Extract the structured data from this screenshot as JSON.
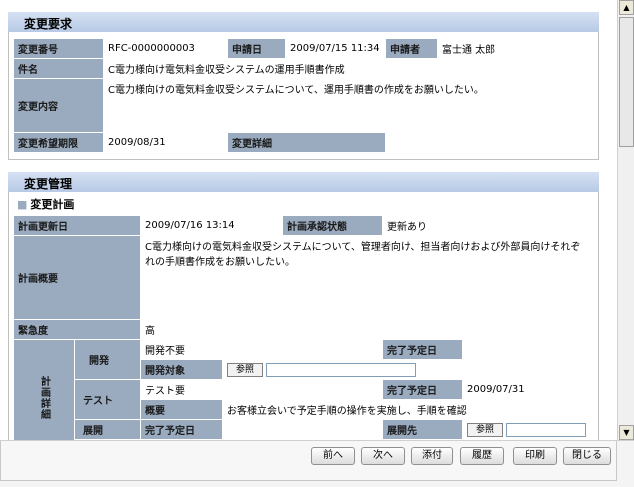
{
  "change_request": {
    "title": "変更要求",
    "number_label": "変更番号",
    "number_value": "RFC-0000000003",
    "date_label": "申請日",
    "date_value": "2009/07/15 11:34",
    "applicant_label": "申請者",
    "applicant_value": "富士通 太郎",
    "subject_label": "件名",
    "subject_value": "C電力様向け電気料金収受システムの運用手順書作成",
    "content_label": "変更内容",
    "content_value": "C電力様向けの電気料金収受システムについて、運用手順書の作成をお願いしたい。",
    "deadline_label": "変更希望期限",
    "deadline_value": "2009/08/31",
    "detail_label": "変更詳細",
    "detail_value": ""
  },
  "change_management": {
    "title": "変更管理",
    "plan_subtitle": "変更計画",
    "plan_updated_label": "計画更新日",
    "plan_updated_value": "2009/07/16 13:14",
    "approval_status_label": "計画承認状態",
    "approval_status_value": "更新あり",
    "overview_label": "計画概要",
    "overview_value": "C電力様向けの電気料金収受システムについて、管理者向け、担当者向けおよび外部員向けそれぞれの手順書作成をお願いしたい。",
    "urgency_label": "緊急度",
    "urgency_value": "高",
    "detail_group_label": "計画詳細",
    "dev_label": "開発",
    "dev_value": "開発不要",
    "dev_due_label": "完了予定日",
    "dev_due_value": "",
    "dev_target_label": "開発対象",
    "ref_button": "参照",
    "test_label": "テスト",
    "test_value": "テスト要",
    "test_due_label": "完了予定日",
    "test_due_value": "2009/07/31",
    "test_summary_label": "概要",
    "test_summary_value": "お客様立会いで予定手順の操作を実施し、手順を確認",
    "deploy_label": "展開",
    "deploy_due_label": "完了予定日",
    "deploy_due_value": "",
    "deploy_target_label": "展開先"
  },
  "buttons": {
    "prev": "前へ",
    "next": "次へ",
    "attach": "添付",
    "history": "履歴",
    "print": "印刷",
    "close": "閉じる"
  },
  "icons": {
    "scroll_up": "▲",
    "scroll_down": "▼",
    "bullet": "■"
  }
}
